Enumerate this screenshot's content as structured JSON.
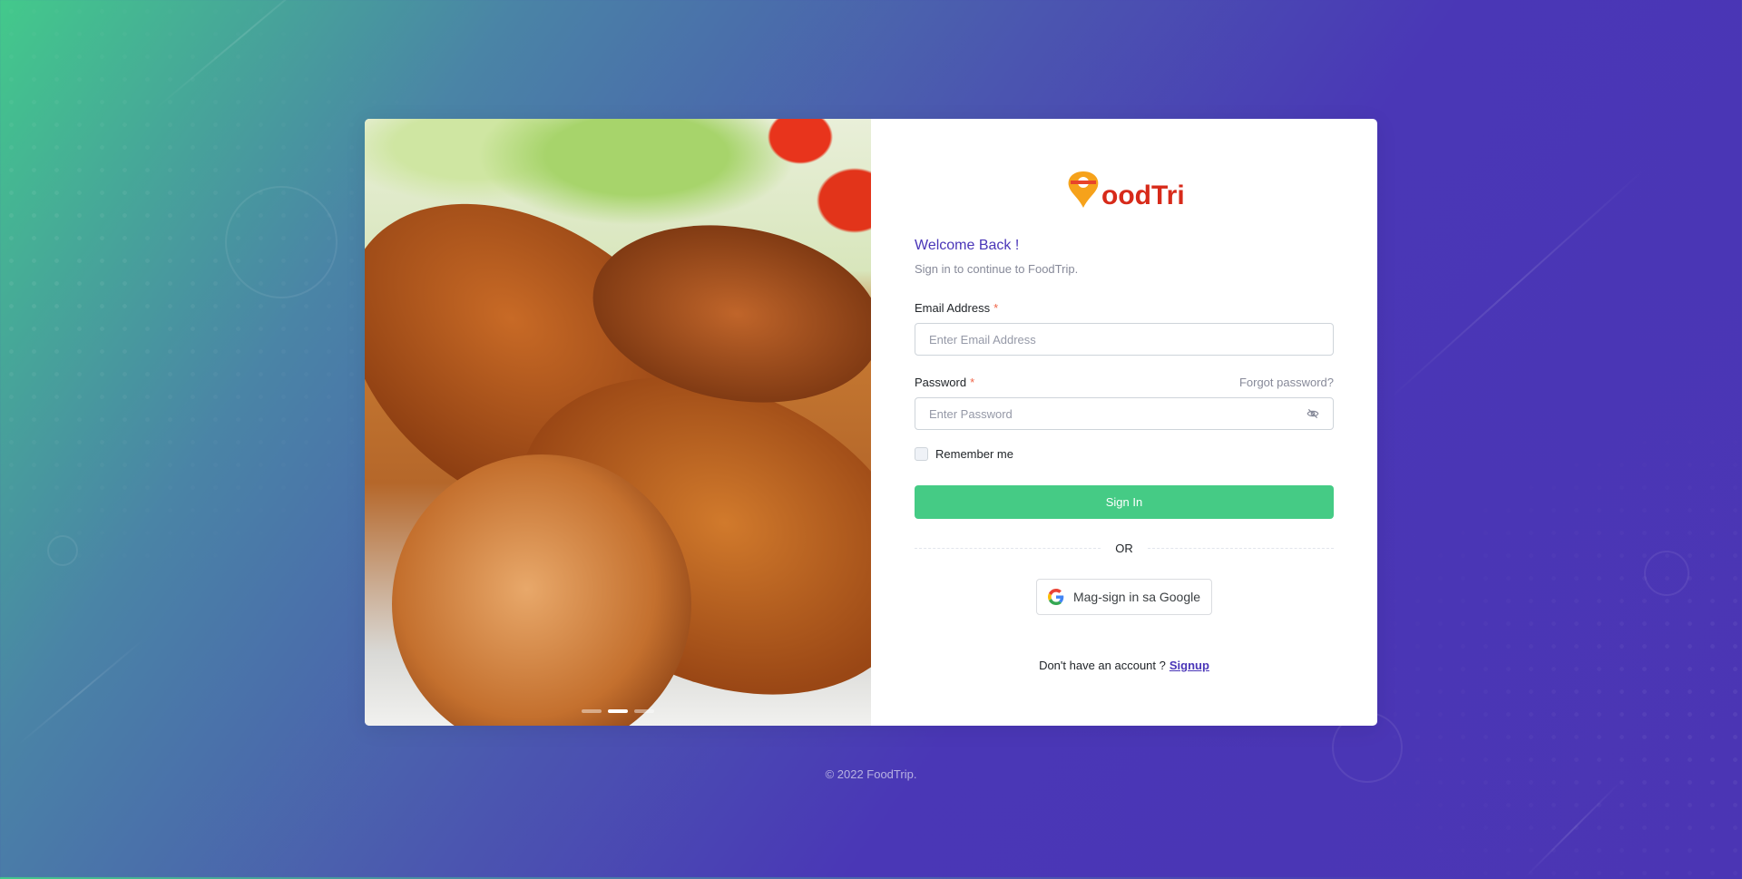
{
  "brand": {
    "name": "FoodTrip",
    "accent": "#4a36b8",
    "primary_button": "#45cb85",
    "required": "#f06548"
  },
  "carousel": {
    "slide_count": 3,
    "active_index": 1
  },
  "form": {
    "welcome_title": "Welcome Back !",
    "subtitle": "Sign in to continue to FoodTrip.",
    "email_label": "Email Address",
    "email_placeholder": "Enter Email Address",
    "password_label": "Password",
    "password_placeholder": "Enter Password",
    "required_mark": "*",
    "forgot_password": "Forgot password?",
    "remember_me": "Remember me",
    "sign_in": "Sign In",
    "or": "OR",
    "google_button": "Mag-sign in sa Google",
    "no_account": "Don't have an account ?",
    "signup_link": "Signup"
  },
  "icons": {
    "password_toggle": "eye-off-icon",
    "google": "google-g-icon",
    "logo_pin": "location-pin-icon"
  },
  "footer": {
    "copyright": "© 2022 FoodTrip."
  }
}
